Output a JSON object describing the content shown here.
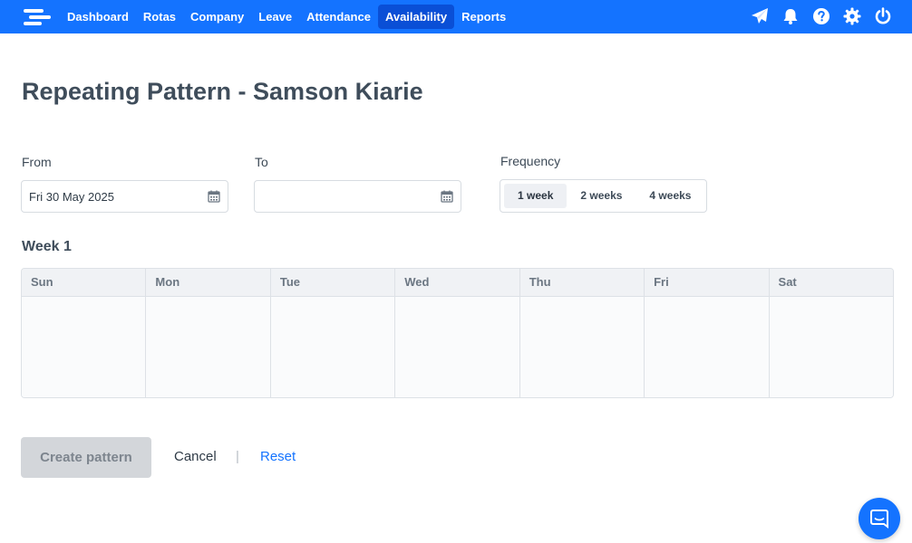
{
  "nav": {
    "items": [
      {
        "label": "Dashboard",
        "active": false
      },
      {
        "label": "Rotas",
        "active": false
      },
      {
        "label": "Company",
        "active": false
      },
      {
        "label": "Leave",
        "active": false
      },
      {
        "label": "Attendance",
        "active": false
      },
      {
        "label": "Availability",
        "active": true
      },
      {
        "label": "Reports",
        "active": false
      }
    ],
    "icons": [
      "paper-plane-icon",
      "bell-icon",
      "help-icon",
      "gear-icon",
      "power-icon"
    ],
    "accent": "#1473ff"
  },
  "page": {
    "title": "Repeating Pattern - Samson Kiarie"
  },
  "form": {
    "from_label": "From",
    "from_value": "Fri 30 May 2025",
    "to_label": "To",
    "to_value": "",
    "frequency_label": "Frequency",
    "frequency_options": [
      "1 week",
      "2 weeks",
      "4 weeks"
    ],
    "frequency_selected": "1 week"
  },
  "week": {
    "title": "Week 1",
    "days": [
      "Sun",
      "Mon",
      "Tue",
      "Wed",
      "Thu",
      "Fri",
      "Sat"
    ]
  },
  "actions": {
    "create_label": "Create pattern",
    "cancel_label": "Cancel",
    "separator": "|",
    "reset_label": "Reset"
  }
}
